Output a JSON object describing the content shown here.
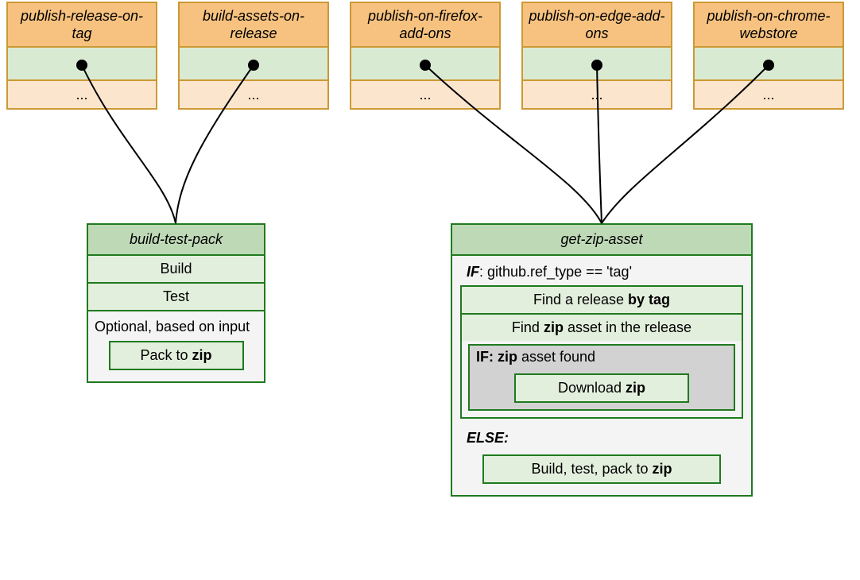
{
  "topboxes": [
    {
      "title": "publish-release-on-tag",
      "dots": "..."
    },
    {
      "title": "build-assets-on-release",
      "dots": "..."
    },
    {
      "title": "publish-on-firefox-add-ons",
      "dots": "..."
    },
    {
      "title": "publish-on-edge-add-ons",
      "dots": "..."
    },
    {
      "title": "publish-on-chrome-webstore",
      "dots": "..."
    }
  ],
  "btp": {
    "title": "build-test-pack",
    "build": "Build",
    "test": "Test",
    "optional": "Optional, based on input",
    "pack_prefix": "Pack to ",
    "pack_bold": "zip"
  },
  "gza": {
    "title": "get-zip-asset",
    "if_kw": "IF",
    "if_cond": ": github.ref_type == 'tag'",
    "find_release_pre": "Find a release ",
    "find_release_bold": "by tag",
    "find_zip_pre": "Find ",
    "find_zip_bold": "zip",
    "find_zip_post": " asset in the release",
    "nested_kw": "IF: ",
    "nested_bold": "zip",
    "nested_post": " asset found",
    "download_pre": "Download ",
    "download_bold": "zip",
    "else_kw": "ELSE:",
    "buildpack_pre": "Build, test, pack to ",
    "buildpack_bold": "zip"
  }
}
